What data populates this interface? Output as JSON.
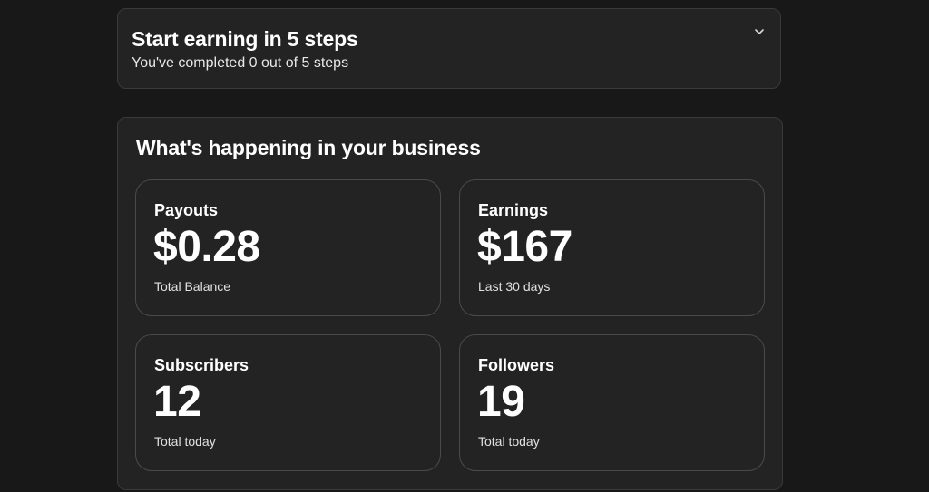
{
  "onboarding": {
    "title": "Start earning in 5 steps",
    "subtitle": "You've completed 0 out of 5 steps",
    "toggle_icon": "chevron-down-icon"
  },
  "business": {
    "title": "What's happening in your business",
    "stats": [
      {
        "label": "Payouts",
        "value": "$0.28",
        "caption": "Total Balance"
      },
      {
        "label": "Earnings",
        "value": "$167",
        "caption": "Last 30 days"
      },
      {
        "label": "Subscribers",
        "value": "12",
        "caption": "Total today"
      },
      {
        "label": "Followers",
        "value": "19",
        "caption": "Total today"
      }
    ]
  },
  "colors": {
    "background": "#181818",
    "card": "#232323",
    "border": "#3a3a3a",
    "text": "#ffffff"
  }
}
